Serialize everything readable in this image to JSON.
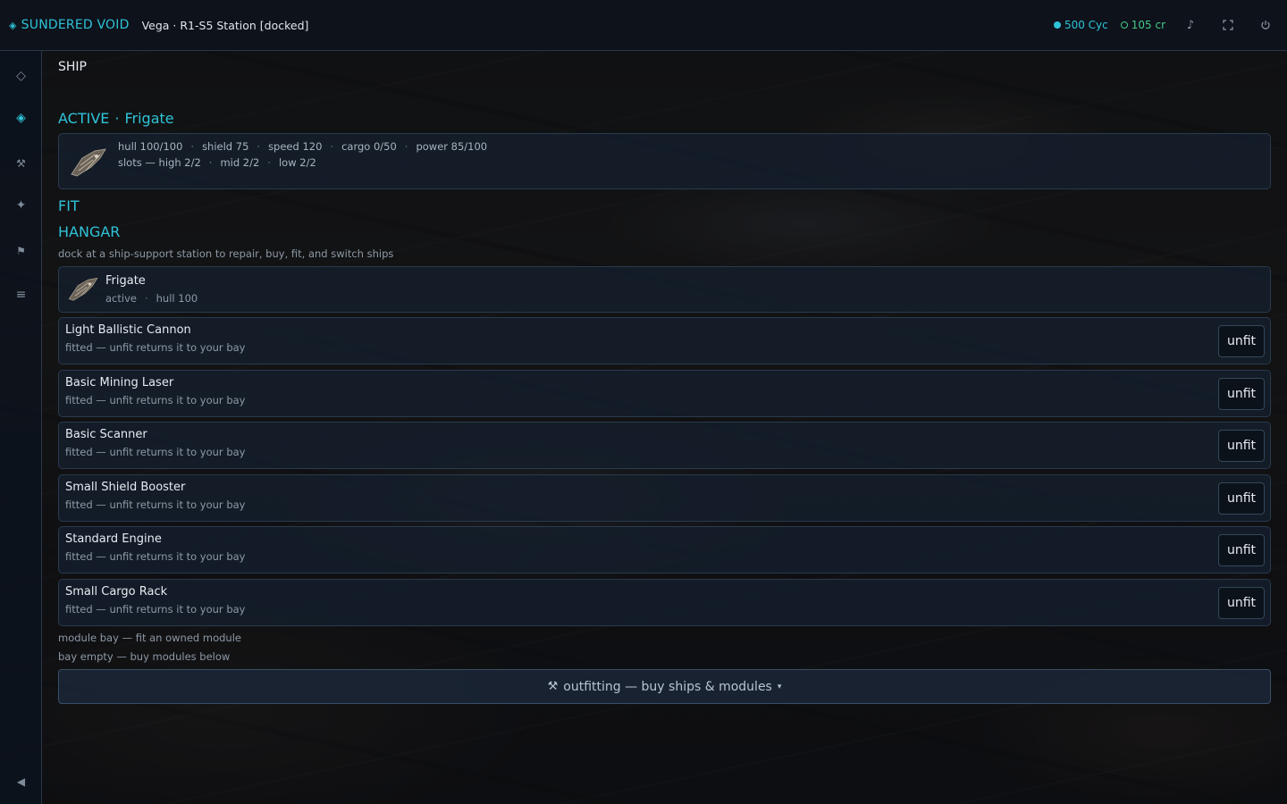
{
  "app": {
    "brand": "SUNDERED VOID",
    "location": "Vega · R1-S5 Station [docked]",
    "currency_cyc": "500 Cyc",
    "currency_cr": "105 cr",
    "colors": {
      "accent": "#2fc3d8",
      "credits": "#47c98a"
    }
  },
  "topbar": {
    "icons": [
      "music-note-icon",
      "fullscreen-icon",
      "power-icon"
    ]
  },
  "sidebar": {
    "items": [
      {
        "name": "map",
        "icon": "diamond-outline-icon"
      },
      {
        "name": "ship",
        "icon": "diamond-filled-icon",
        "active": true
      },
      {
        "name": "tools",
        "icon": "tools-icon"
      },
      {
        "name": "skills",
        "icon": "star-icon"
      },
      {
        "name": "missions",
        "icon": "flag-icon"
      },
      {
        "name": "menu",
        "icon": "menu-icon"
      },
      {
        "name": "collapse",
        "icon": "collapse-icon"
      }
    ]
  },
  "page": {
    "title": "SHIP",
    "active_label": "ACTIVE",
    "active_sep": "·",
    "active_ship": "Frigate",
    "stats_line1": [
      "hull 100/100",
      "shield 75",
      "speed 120",
      "cargo 0/50",
      "power 85/100"
    ],
    "stats_line2": [
      "slots — high 2/2",
      "mid 2/2",
      "low 2/2"
    ],
    "fit_heading": "FIT",
    "hangar_heading": "HANGAR",
    "hangar_hint": "dock at a ship-support station to repair, buy, fit, and switch ships",
    "hangar_ship": {
      "name": "Frigate",
      "status": "active",
      "hull": "hull 100"
    },
    "modules": [
      {
        "name": "Light Ballistic Cannon",
        "status": "fitted — unfit returns it to your bay",
        "action": "unfit"
      },
      {
        "name": "Basic Mining Laser",
        "status": "fitted — unfit returns it to your bay",
        "action": "unfit"
      },
      {
        "name": "Basic Scanner",
        "status": "fitted — unfit returns it to your bay",
        "action": "unfit"
      },
      {
        "name": "Small Shield Booster",
        "status": "fitted — unfit returns it to your bay",
        "action": "unfit"
      },
      {
        "name": "Standard Engine",
        "status": "fitted — unfit returns it to your bay",
        "action": "unfit"
      },
      {
        "name": "Small Cargo Rack",
        "status": "fitted — unfit returns it to your bay",
        "action": "unfit"
      }
    ],
    "module_bay_hint": "module bay — fit an owned module",
    "bay_empty_hint": "bay empty — buy modules below",
    "outfitting_label": "outfitting — buy ships & modules"
  }
}
